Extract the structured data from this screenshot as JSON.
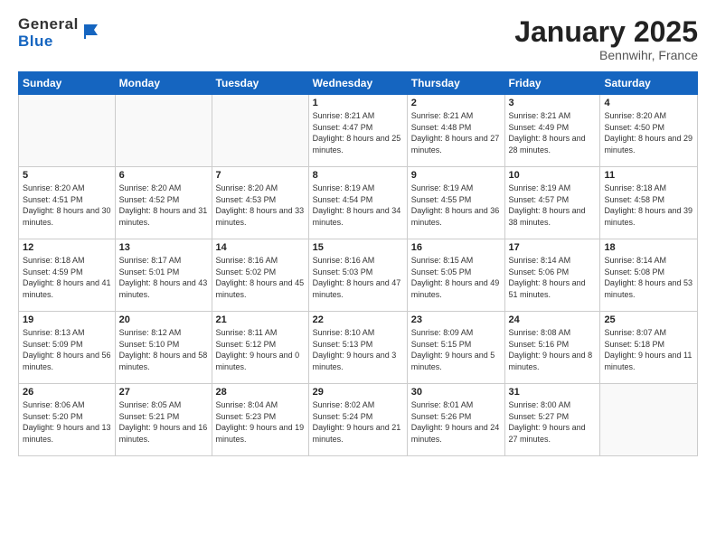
{
  "header": {
    "logo": {
      "text_general": "General",
      "text_blue": "Blue"
    },
    "title": "January 2025",
    "location": "Bennwihr, France"
  },
  "calendar": {
    "headers": [
      "Sunday",
      "Monday",
      "Tuesday",
      "Wednesday",
      "Thursday",
      "Friday",
      "Saturday"
    ],
    "weeks": [
      [
        {
          "day": "",
          "empty": true
        },
        {
          "day": "",
          "empty": true
        },
        {
          "day": "",
          "empty": true
        },
        {
          "day": "1",
          "sunrise": "8:21 AM",
          "sunset": "4:47 PM",
          "daylight": "8 hours and 25 minutes."
        },
        {
          "day": "2",
          "sunrise": "8:21 AM",
          "sunset": "4:48 PM",
          "daylight": "8 hours and 27 minutes."
        },
        {
          "day": "3",
          "sunrise": "8:21 AM",
          "sunset": "4:49 PM",
          "daylight": "8 hours and 28 minutes."
        },
        {
          "day": "4",
          "sunrise": "8:20 AM",
          "sunset": "4:50 PM",
          "daylight": "8 hours and 29 minutes."
        }
      ],
      [
        {
          "day": "5",
          "sunrise": "8:20 AM",
          "sunset": "4:51 PM",
          "daylight": "8 hours and 30 minutes."
        },
        {
          "day": "6",
          "sunrise": "8:20 AM",
          "sunset": "4:52 PM",
          "daylight": "8 hours and 31 minutes."
        },
        {
          "day": "7",
          "sunrise": "8:20 AM",
          "sunset": "4:53 PM",
          "daylight": "8 hours and 33 minutes."
        },
        {
          "day": "8",
          "sunrise": "8:19 AM",
          "sunset": "4:54 PM",
          "daylight": "8 hours and 34 minutes."
        },
        {
          "day": "9",
          "sunrise": "8:19 AM",
          "sunset": "4:55 PM",
          "daylight": "8 hours and 36 minutes."
        },
        {
          "day": "10",
          "sunrise": "8:19 AM",
          "sunset": "4:57 PM",
          "daylight": "8 hours and 38 minutes."
        },
        {
          "day": "11",
          "sunrise": "8:18 AM",
          "sunset": "4:58 PM",
          "daylight": "8 hours and 39 minutes."
        }
      ],
      [
        {
          "day": "12",
          "sunrise": "8:18 AM",
          "sunset": "4:59 PM",
          "daylight": "8 hours and 41 minutes."
        },
        {
          "day": "13",
          "sunrise": "8:17 AM",
          "sunset": "5:01 PM",
          "daylight": "8 hours and 43 minutes."
        },
        {
          "day": "14",
          "sunrise": "8:16 AM",
          "sunset": "5:02 PM",
          "daylight": "8 hours and 45 minutes."
        },
        {
          "day": "15",
          "sunrise": "8:16 AM",
          "sunset": "5:03 PM",
          "daylight": "8 hours and 47 minutes."
        },
        {
          "day": "16",
          "sunrise": "8:15 AM",
          "sunset": "5:05 PM",
          "daylight": "8 hours and 49 minutes."
        },
        {
          "day": "17",
          "sunrise": "8:14 AM",
          "sunset": "5:06 PM",
          "daylight": "8 hours and 51 minutes."
        },
        {
          "day": "18",
          "sunrise": "8:14 AM",
          "sunset": "5:08 PM",
          "daylight": "8 hours and 53 minutes."
        }
      ],
      [
        {
          "day": "19",
          "sunrise": "8:13 AM",
          "sunset": "5:09 PM",
          "daylight": "8 hours and 56 minutes."
        },
        {
          "day": "20",
          "sunrise": "8:12 AM",
          "sunset": "5:10 PM",
          "daylight": "8 hours and 58 minutes."
        },
        {
          "day": "21",
          "sunrise": "8:11 AM",
          "sunset": "5:12 PM",
          "daylight": "9 hours and 0 minutes."
        },
        {
          "day": "22",
          "sunrise": "8:10 AM",
          "sunset": "5:13 PM",
          "daylight": "9 hours and 3 minutes."
        },
        {
          "day": "23",
          "sunrise": "8:09 AM",
          "sunset": "5:15 PM",
          "daylight": "9 hours and 5 minutes."
        },
        {
          "day": "24",
          "sunrise": "8:08 AM",
          "sunset": "5:16 PM",
          "daylight": "9 hours and 8 minutes."
        },
        {
          "day": "25",
          "sunrise": "8:07 AM",
          "sunset": "5:18 PM",
          "daylight": "9 hours and 11 minutes."
        }
      ],
      [
        {
          "day": "26",
          "sunrise": "8:06 AM",
          "sunset": "5:20 PM",
          "daylight": "9 hours and 13 minutes."
        },
        {
          "day": "27",
          "sunrise": "8:05 AM",
          "sunset": "5:21 PM",
          "daylight": "9 hours and 16 minutes."
        },
        {
          "day": "28",
          "sunrise": "8:04 AM",
          "sunset": "5:23 PM",
          "daylight": "9 hours and 19 minutes."
        },
        {
          "day": "29",
          "sunrise": "8:02 AM",
          "sunset": "5:24 PM",
          "daylight": "9 hours and 21 minutes."
        },
        {
          "day": "30",
          "sunrise": "8:01 AM",
          "sunset": "5:26 PM",
          "daylight": "9 hours and 24 minutes."
        },
        {
          "day": "31",
          "sunrise": "8:00 AM",
          "sunset": "5:27 PM",
          "daylight": "9 hours and 27 minutes."
        },
        {
          "day": "",
          "empty": true
        }
      ]
    ]
  }
}
